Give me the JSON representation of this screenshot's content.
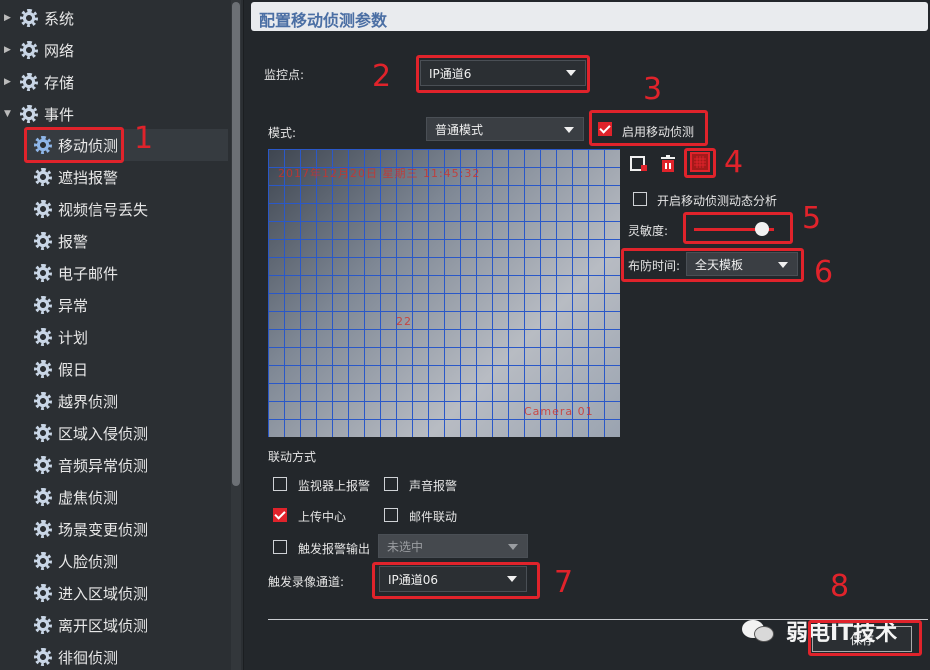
{
  "sidebar": {
    "top_items": [
      {
        "label": "系统"
      },
      {
        "label": "网络"
      },
      {
        "label": "存储"
      },
      {
        "label": "事件"
      }
    ],
    "event_items": [
      {
        "label": "移动侦测"
      },
      {
        "label": "遮挡报警"
      },
      {
        "label": "视频信号丢失"
      },
      {
        "label": "报警"
      },
      {
        "label": "电子邮件"
      },
      {
        "label": "异常"
      },
      {
        "label": "计划"
      },
      {
        "label": "假日"
      },
      {
        "label": "越界侦测"
      },
      {
        "label": "区域入侵侦测"
      },
      {
        "label": "音频异常侦测"
      },
      {
        "label": "虚焦侦测"
      },
      {
        "label": "场景变更侦测"
      },
      {
        "label": "人脸侦测"
      },
      {
        "label": "进入区域侦测"
      },
      {
        "label": "离开区域侦测"
      },
      {
        "label": "徘徊侦测"
      }
    ]
  },
  "header": {
    "title": "配置移动侦测参数"
  },
  "form": {
    "channel_label": "监控点:",
    "channel_value": "IP通道6",
    "mode_label": "模式:",
    "mode_value": "普通模式",
    "enable_label": "启用移动侦测",
    "enable_checked": true,
    "dynamic_label": "开启移动侦测动态分析",
    "sensitivity_label": "灵敏度:",
    "sensitivity_level": 0.85,
    "schedule_label": "布防时间:",
    "schedule_value": "全天模板"
  },
  "video": {
    "osd_datetime": "2017年12月20日 星期三 11:45:32",
    "osd_center": "22",
    "osd_camera": "Camera 01"
  },
  "linkage": {
    "title": "联动方式",
    "monitor_alarm": {
      "label": "监视器上报警",
      "checked": false
    },
    "audio_alarm": {
      "label": "声音报警",
      "checked": false
    },
    "upload_center": {
      "label": "上传中心",
      "checked": true
    },
    "email_link": {
      "label": "邮件联动",
      "checked": false
    },
    "alarm_output": {
      "label": "触发报警输出",
      "checked": false
    },
    "alarm_output_value": "未选中"
  },
  "record": {
    "label": "触发录像通道:",
    "value": "IP通道06"
  },
  "annotations": [
    "1",
    "2",
    "3",
    "4",
    "5",
    "6",
    "7",
    "8"
  ],
  "watermark": "弱电IT技术",
  "save_label": "保存",
  "colors": {
    "accent": "#e0232b",
    "grid": "#2a58c8",
    "title": "#4b6fa4"
  }
}
